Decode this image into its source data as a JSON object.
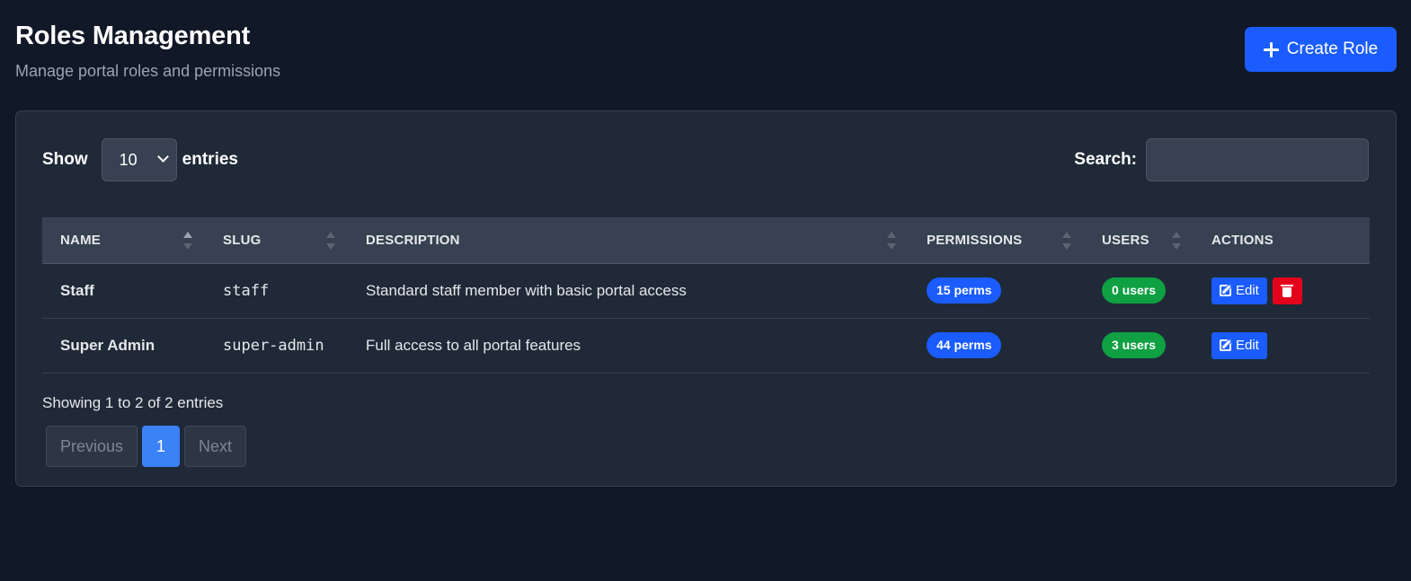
{
  "header": {
    "title": "Roles Management",
    "subtitle": "Manage portal roles and permissions",
    "create_label": "Create Role"
  },
  "controls": {
    "show_label": "Show",
    "entries_label": "entries",
    "page_length": "10",
    "search_label": "Search:",
    "search_value": ""
  },
  "table": {
    "columns": [
      "NAME",
      "SLUG",
      "DESCRIPTION",
      "PERMISSIONS",
      "USERS",
      "ACTIONS"
    ],
    "rows": [
      {
        "name": "Staff",
        "slug": "staff",
        "description": "Standard staff member with basic portal access",
        "permissions": "15 perms",
        "users": "0 users",
        "edit": "Edit",
        "can_delete": true
      },
      {
        "name": "Super Admin",
        "slug": "super-admin",
        "description": "Full access to all portal features",
        "permissions": "44 perms",
        "users": "3 users",
        "edit": "Edit",
        "can_delete": false
      }
    ]
  },
  "footer": {
    "info": "Showing 1 to 2 of 2 entries",
    "previous": "Previous",
    "current_page": "1",
    "next": "Next"
  },
  "colors": {
    "background": "#111827",
    "card": "#1f2937",
    "primary": "#1a5cff",
    "success": "#0ea042",
    "danger": "#e3001b"
  }
}
